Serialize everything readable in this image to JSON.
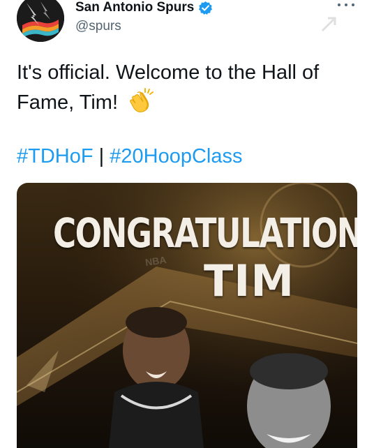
{
  "tweet": {
    "display_name": "San Antonio Spurs",
    "handle": "@spurs",
    "verified": true,
    "text": "It's official. Welcome to the Hall of Fame, Tim!",
    "emoji": "clapping-hands",
    "hashtags": [
      "#TDHoF",
      "#20HoopClass"
    ],
    "hashtag_separator": "|",
    "more_icon": "more-dots-icon"
  },
  "media": {
    "headline": "CONGRATULATIONS,",
    "subline": "TIM",
    "watermark": "NBA"
  },
  "colors": {
    "link": "#1d9bf0",
    "verified": "#1d9bf0",
    "text": "#0f1419",
    "secondary": "#536471"
  }
}
